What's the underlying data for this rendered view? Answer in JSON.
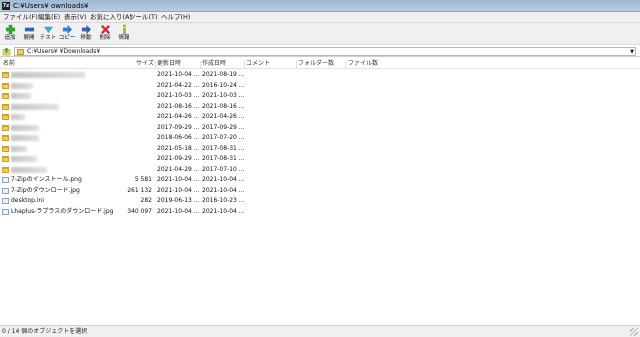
{
  "window": {
    "title": "C:¥Users¥      ownloads¥",
    "app_icon": "7z"
  },
  "menu": [
    "ファイル(F)",
    "編集(E)",
    "表示(V)",
    "お気に入り(A)",
    "ツール(T)",
    "ヘルプ(H)"
  ],
  "toolbar": [
    {
      "label": "追加",
      "icon": "add-icon",
      "color": "#2fa334"
    },
    {
      "label": "展開",
      "icon": "extract-icon",
      "color": "#2b62c0"
    },
    {
      "label": "テスト",
      "icon": "test-icon",
      "color": "#32b0c2"
    },
    {
      "label": "コピー",
      "icon": "copy-icon",
      "color": "#2f7ecf"
    },
    {
      "label": "移動",
      "icon": "move-icon",
      "color": "#3b5fb0"
    },
    {
      "label": "削除",
      "icon": "delete-icon",
      "color": "#d42a2a"
    },
    {
      "label": "情報",
      "icon": "info-icon",
      "color": "#c9a11b"
    }
  ],
  "address": {
    "path": "C:¥Users¥         ¥Downloads¥"
  },
  "columns": [
    "名前",
    "サイズ",
    "更新日時",
    "作成日時",
    "コメント",
    "フォルダー数",
    "ファイル数"
  ],
  "rows": [
    {
      "type": "folder",
      "name": "",
      "size": "",
      "modified": "2021-10-04 ...",
      "created": "2021-08-19 ..."
    },
    {
      "type": "folder",
      "name": "",
      "size": "",
      "modified": "2021-04-22 ...",
      "created": "2016-10-24 ..."
    },
    {
      "type": "folder",
      "name": "",
      "size": "",
      "modified": "2021-10-03 ...",
      "created": "2021-10-03 ..."
    },
    {
      "type": "folder",
      "name": "",
      "size": "",
      "modified": "2021-08-16 ...",
      "created": "2021-08-16 ..."
    },
    {
      "type": "folder",
      "name": "",
      "size": "",
      "modified": "2021-04-26 ...",
      "created": "2021-04-26 ..."
    },
    {
      "type": "folder",
      "name": "",
      "size": "",
      "modified": "2017-09-29 ...",
      "created": "2017-09-29 ..."
    },
    {
      "type": "folder",
      "name": "",
      "size": "",
      "modified": "2018-06-06 ...",
      "created": "2017-07-20 ..."
    },
    {
      "type": "folder",
      "name": "",
      "size": "",
      "modified": "2021-05-18 ...",
      "created": "2017-08-31 ..."
    },
    {
      "type": "folder",
      "name": "",
      "size": "",
      "modified": "2021-09-29 ...",
      "created": "2017-08-31 ..."
    },
    {
      "type": "folder",
      "name": "",
      "size": "",
      "modified": "2021-04-29 ...",
      "created": "2017-07-10 ..."
    },
    {
      "type": "file",
      "name": "7-Zipのインストール.png",
      "size": "5 581",
      "modified": "2021-10-04 ...",
      "created": "2021-10-04 ..."
    },
    {
      "type": "file",
      "name": "7-Zipのダウンロード.jpg",
      "size": "261 132",
      "modified": "2021-10-04 ...",
      "created": "2021-10-04 ..."
    },
    {
      "type": "file",
      "name": "desktop.ini",
      "size": "282",
      "modified": "2019-06-13 ...",
      "created": "2016-10-23 ..."
    },
    {
      "type": "file",
      "name": "Lhaplus-ラプラスのダウンロード.jpg",
      "size": "340 097",
      "modified": "2021-10-04 ...",
      "created": "2021-10-04 ..."
    }
  ],
  "status": "0 / 14 個のオブジェクトを選択"
}
